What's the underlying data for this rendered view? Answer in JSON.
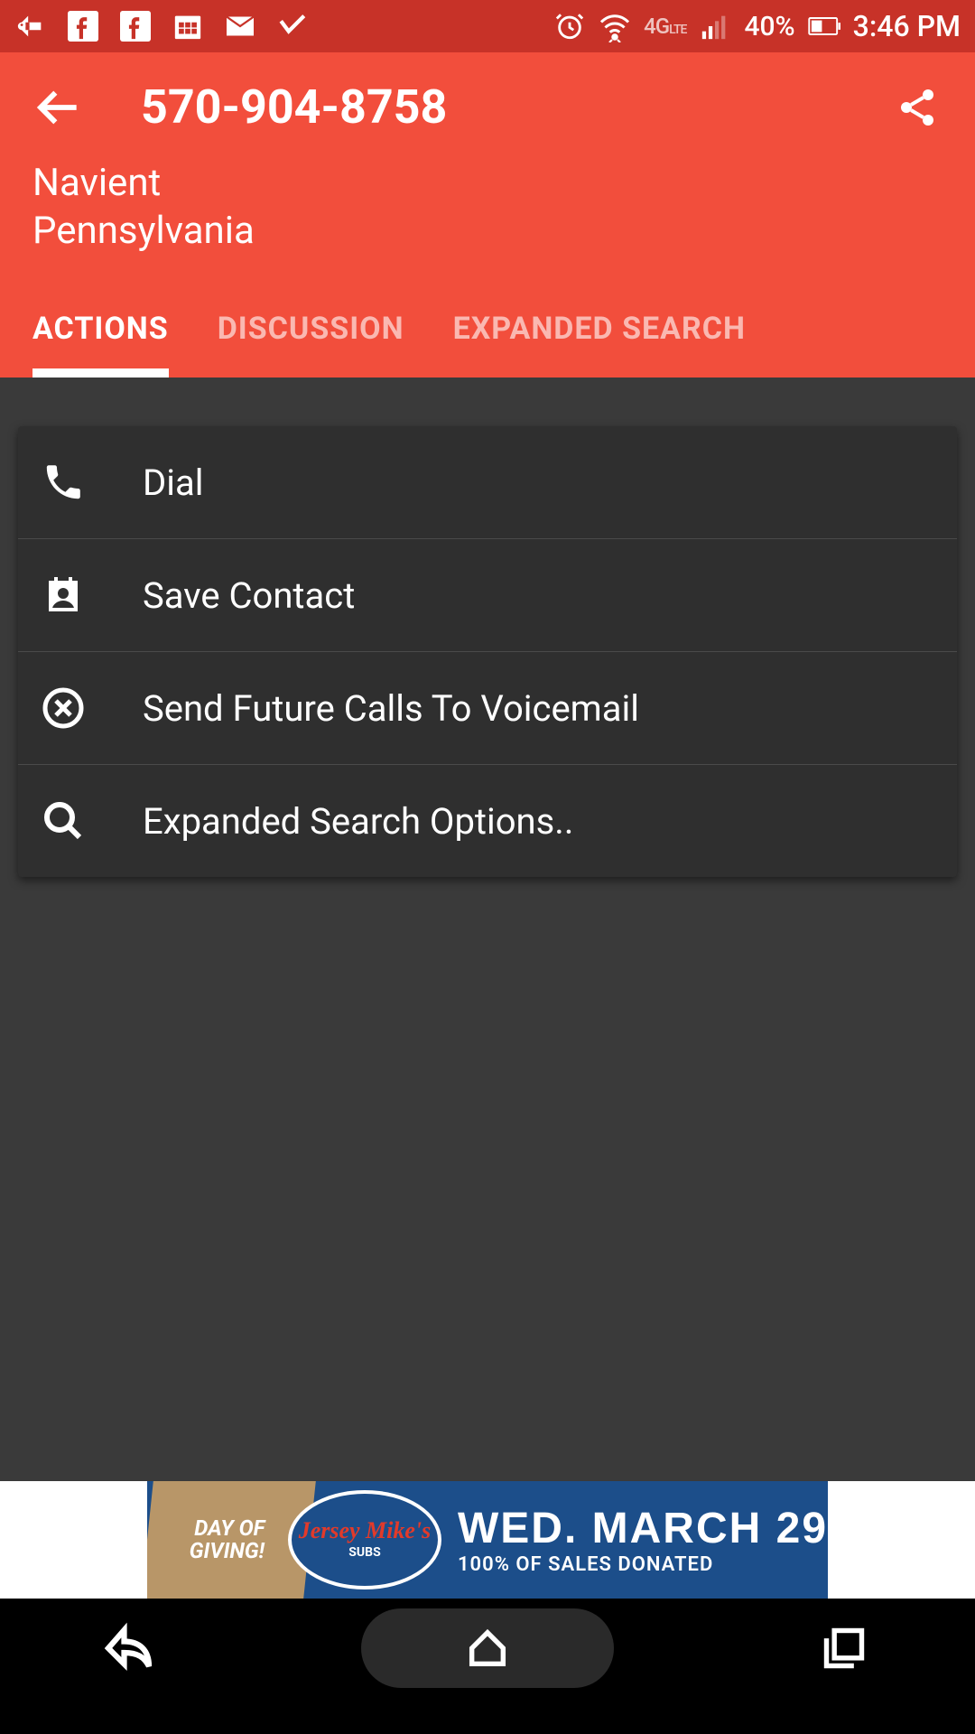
{
  "status_bar": {
    "battery_pct": "40%",
    "time": "3:46 PM",
    "network": "4G LTE"
  },
  "header": {
    "phone_number": "570-904-8758",
    "caller_name": "Navient",
    "caller_location": "Pennsylvania"
  },
  "tabs": [
    {
      "label": "ACTIONS",
      "active": true
    },
    {
      "label": "DISCUSSION",
      "active": false
    },
    {
      "label": "EXPANDED SEARCH",
      "active": false
    }
  ],
  "actions": [
    {
      "icon": "phone-icon",
      "label": "Dial"
    },
    {
      "icon": "contact-icon",
      "label": "Save Contact"
    },
    {
      "icon": "block-icon",
      "label": "Send Future Calls To Voicemail"
    },
    {
      "icon": "search-icon",
      "label": "Expanded Search Options.."
    }
  ],
  "ad": {
    "left_line1": "DAY OF",
    "left_line2": "GIVING!",
    "logo_text": "Jersey Mike's",
    "logo_sub": "SUBS",
    "date": "WED. MARCH 29",
    "tagline": "100% OF SALES DONATED"
  }
}
